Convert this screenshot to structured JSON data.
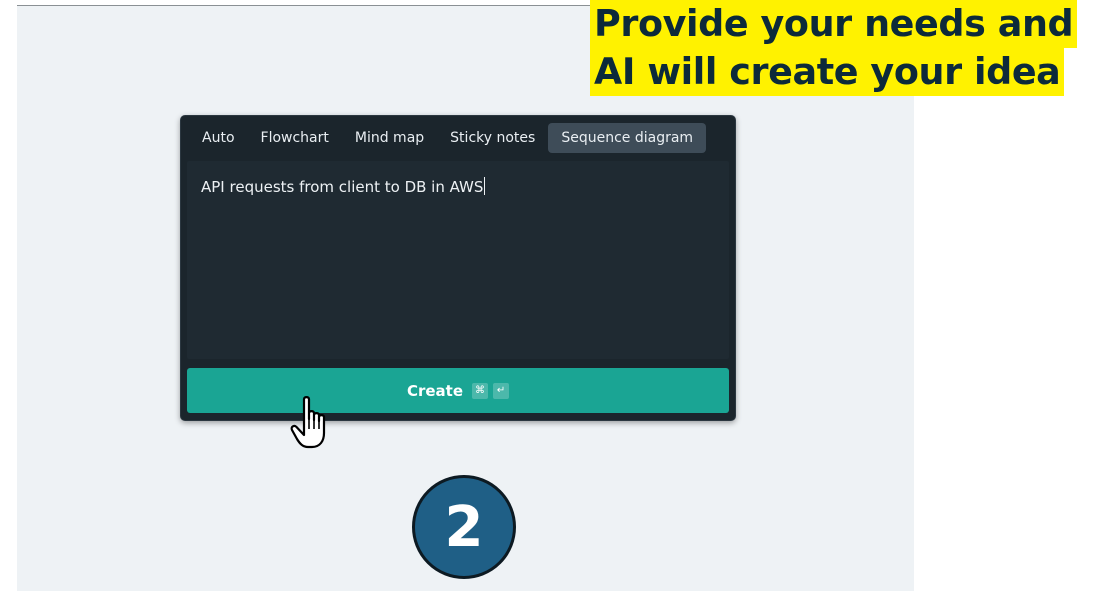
{
  "headline": {
    "line1": "Provide your needs and",
    "line2": "AI will create your idea"
  },
  "tabs": [
    {
      "label": "Auto",
      "active": false
    },
    {
      "label": "Flowchart",
      "active": false
    },
    {
      "label": "Mind map",
      "active": false
    },
    {
      "label": "Sticky notes",
      "active": false
    },
    {
      "label": "Sequence diagram",
      "active": true
    }
  ],
  "prompt": {
    "value": "API requests from client to DB in AWS"
  },
  "create_button": {
    "label": "Create",
    "shortcut_cmd": "⌘",
    "shortcut_enter": "↵"
  },
  "step": {
    "number": "2"
  },
  "icons": {
    "cursor": "hand-pointer-icon"
  },
  "colors": {
    "highlight": "#fff200",
    "panel_bg": "#1b252c",
    "button_bg": "#1aa594",
    "step_circle": "#1f5f86",
    "slide_bg": "#eef2f5"
  }
}
